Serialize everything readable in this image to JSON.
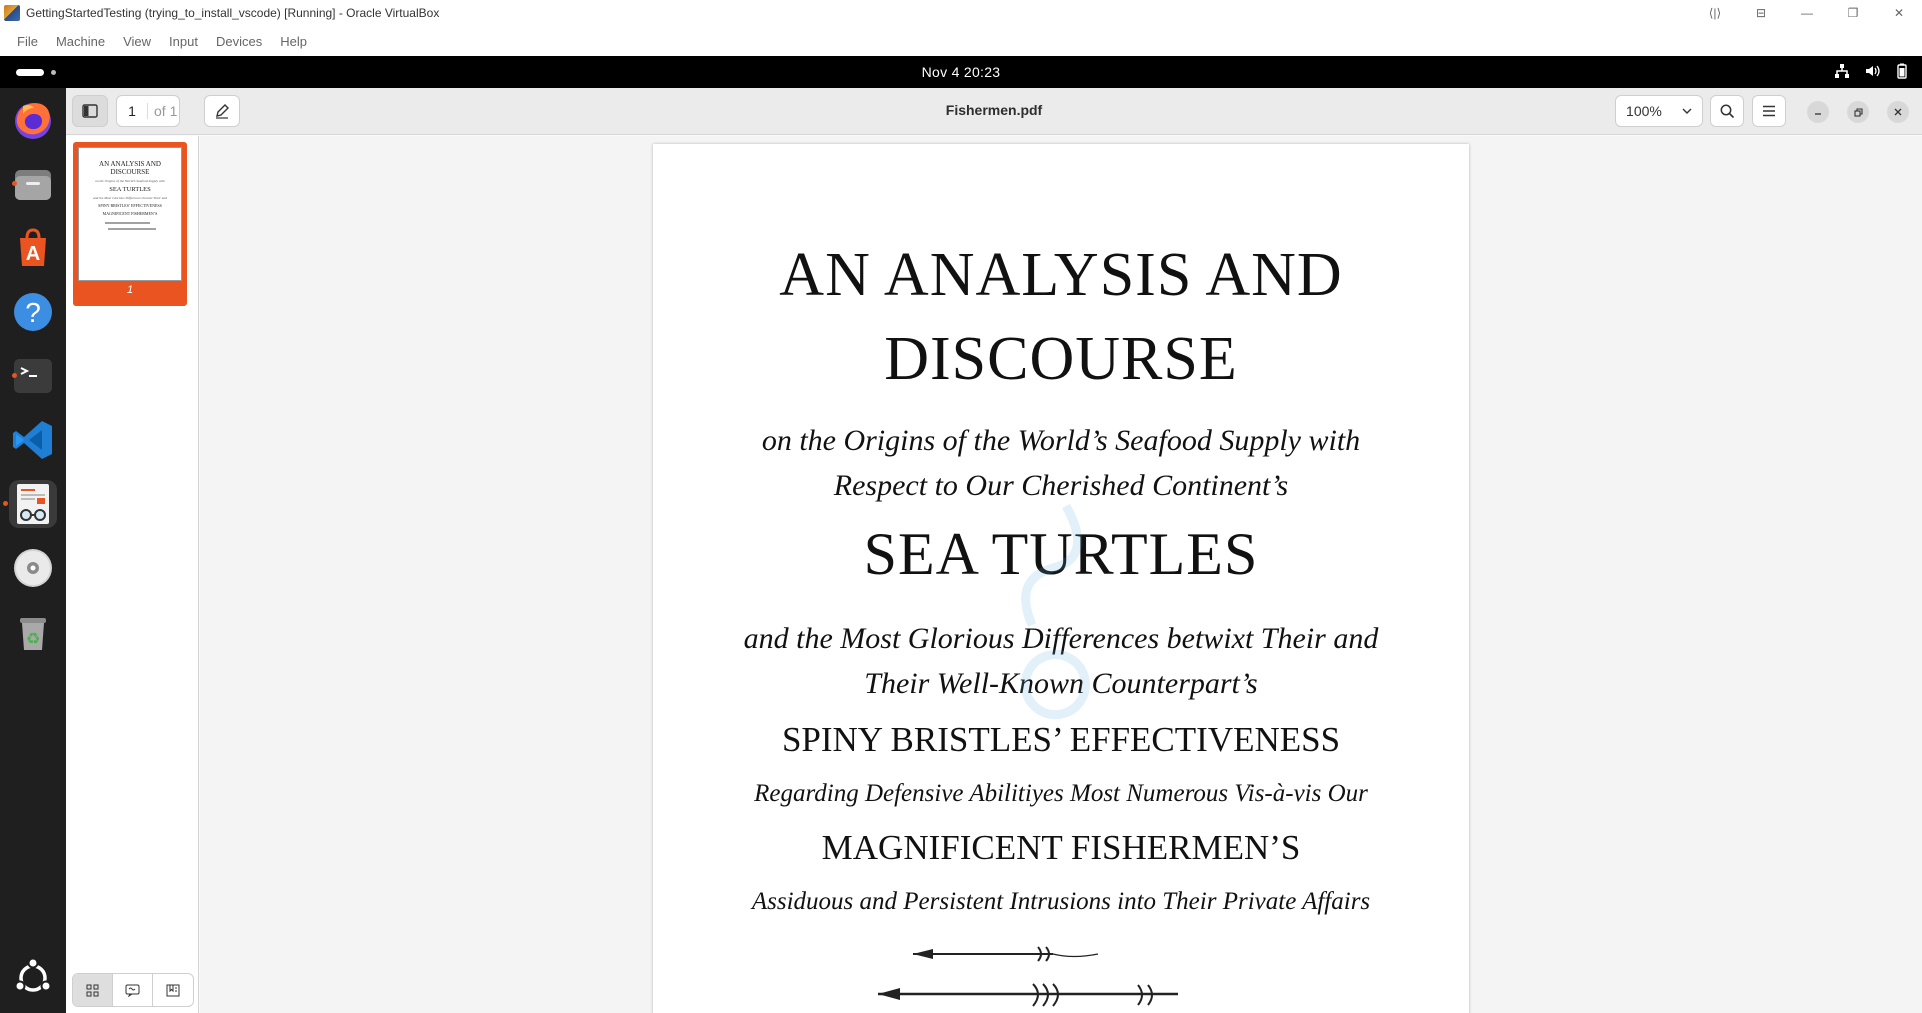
{
  "host_window": {
    "title": "GettingStartedTesting (trying_to_install_vscode) [Running] - Oracle VirtualBox",
    "menu": [
      "File",
      "Machine",
      "View",
      "Input",
      "Devices",
      "Help"
    ],
    "controls": [
      "⟨|⟩",
      "⊟",
      "—",
      "❐",
      "✕"
    ]
  },
  "guest_topbar": {
    "clock": "Nov 4  20:23",
    "tray_icons": [
      "network-icon",
      "volume-icon",
      "battery-icon"
    ]
  },
  "dock": {
    "apps": [
      {
        "name": "firefox",
        "running": false
      },
      {
        "name": "files",
        "running": true
      },
      {
        "name": "app-center",
        "running": false
      },
      {
        "name": "help",
        "running": false
      },
      {
        "name": "terminal",
        "running": true
      },
      {
        "name": "vscode",
        "running": false
      },
      {
        "name": "document-viewer",
        "running": true,
        "active": true
      },
      {
        "name": "disc",
        "running": false
      },
      {
        "name": "trash",
        "running": false
      }
    ],
    "bottom": "show-apps"
  },
  "viewer": {
    "page_input": "1",
    "page_total": "of 1",
    "doc_title": "Fishermen.pdf",
    "zoom": "100%",
    "thumbnail_label": "1"
  },
  "pdf": {
    "title_line1": "AN ANALYSIS AND",
    "title_line2": "DISCOURSE",
    "sub1_line1": "on the Origins of the World’s Seafood Supply with",
    "sub1_line2": "Respect to Our Cherished Continent’s",
    "heading2": "SEA TURTLES",
    "sub2_line1": "and the Most Glorious Differences betwixt Their and",
    "sub2_line2": "Their Well-Known Counterpart’s",
    "heading3": "SPINY BRISTLES’ EFFECTIVENESS",
    "sub3": "Regarding Defensive Abilitiyes Most Numerous Vis-à-vis Our",
    "heading4": "MAGNIFICENT FISHERMEN’S",
    "sub4": "Assiduous and Persistent Intrusions into Their Private Affairs"
  },
  "thumbnail_text": {
    "t1": "AN ANALYSIS AND DISCOURSE",
    "t3": "SEA TURTLES",
    "t4a": "SPINY BRISTLES’ EFFECTIVENESS",
    "t4b": "MAGNIFICENT FISHERMEN’S"
  },
  "colors": {
    "accent": "#e95420",
    "vscode": "#1f7fd4",
    "dock_bg": "#1f1f1f"
  }
}
